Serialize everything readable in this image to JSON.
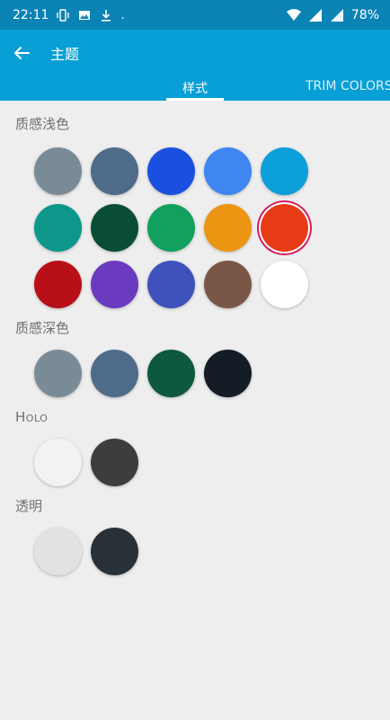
{
  "status_bar": {
    "time": "22:11",
    "battery": "78%",
    "icons": [
      "vibrate-icon",
      "image-icon",
      "download-icon",
      "wifi-icon",
      "signal-icon",
      "4g-icon"
    ]
  },
  "app_bar": {
    "title": "主题",
    "back_icon": "arrow-left-icon"
  },
  "tabs": [
    {
      "label": "样式",
      "selected": true
    },
    {
      "label": "TRIM COLORS",
      "selected": false
    }
  ],
  "sections": [
    {
      "label": "质感浅色",
      "rows": [
        [
          "#7a8b98",
          "#4f6b8a",
          "#1a50e0",
          "#3f86f3",
          "#0c9fda"
        ],
        [
          "#0c978a",
          "#0a4d36",
          "#12a05e",
          "#ec9513",
          "#e63b16"
        ],
        [
          "#b90f19",
          "#6b3bbf",
          "#3f51bc",
          "#7a5647",
          "#ffffff"
        ]
      ],
      "selected": "#e63b16"
    },
    {
      "label": "质感深色",
      "rows": [
        [
          "#7a8b98",
          "#4f6b8a",
          "#0e5840",
          "#141c26"
        ]
      ]
    },
    {
      "label": "Holo",
      "rows": [
        [
          "#f2f2f2",
          "#3d3d3d"
        ]
      ]
    },
    {
      "label": "透明",
      "rows": [
        [
          "#e2e2e2",
          "#283038"
        ]
      ]
    }
  ]
}
